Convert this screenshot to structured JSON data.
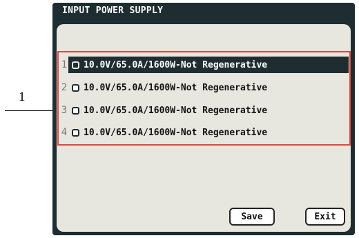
{
  "annotation": {
    "label": "1"
  },
  "screen": {
    "title": "INPUT POWER SUPPLY",
    "options": [
      {
        "index": "1",
        "text": "10.0V/65.0A/1600W-Not Regenerative",
        "selected": true
      },
      {
        "index": "2",
        "text": "10.0V/65.0A/1600W-Not Regenerative",
        "selected": false
      },
      {
        "index": "3",
        "text": "10.0V/65.0A/1600W-Not Regenerative",
        "selected": false
      },
      {
        "index": "4",
        "text": "10.0V/65.0A/1600W-Not Regenerative",
        "selected": false
      }
    ],
    "buttons": {
      "save": "Save",
      "exit": "Exit"
    }
  }
}
